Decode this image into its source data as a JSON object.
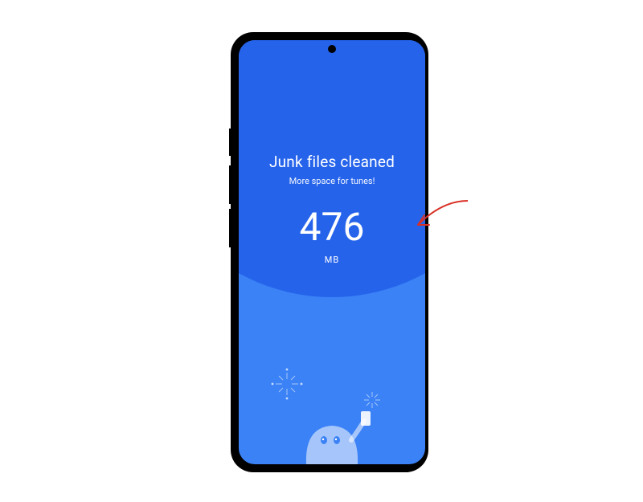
{
  "cleaner": {
    "title": "Junk files cleaned",
    "subtitle": "More space for tunes!",
    "amount": "476",
    "unit": "MB"
  },
  "colors": {
    "circle": "#2563eb",
    "background": "#3b82f6"
  }
}
